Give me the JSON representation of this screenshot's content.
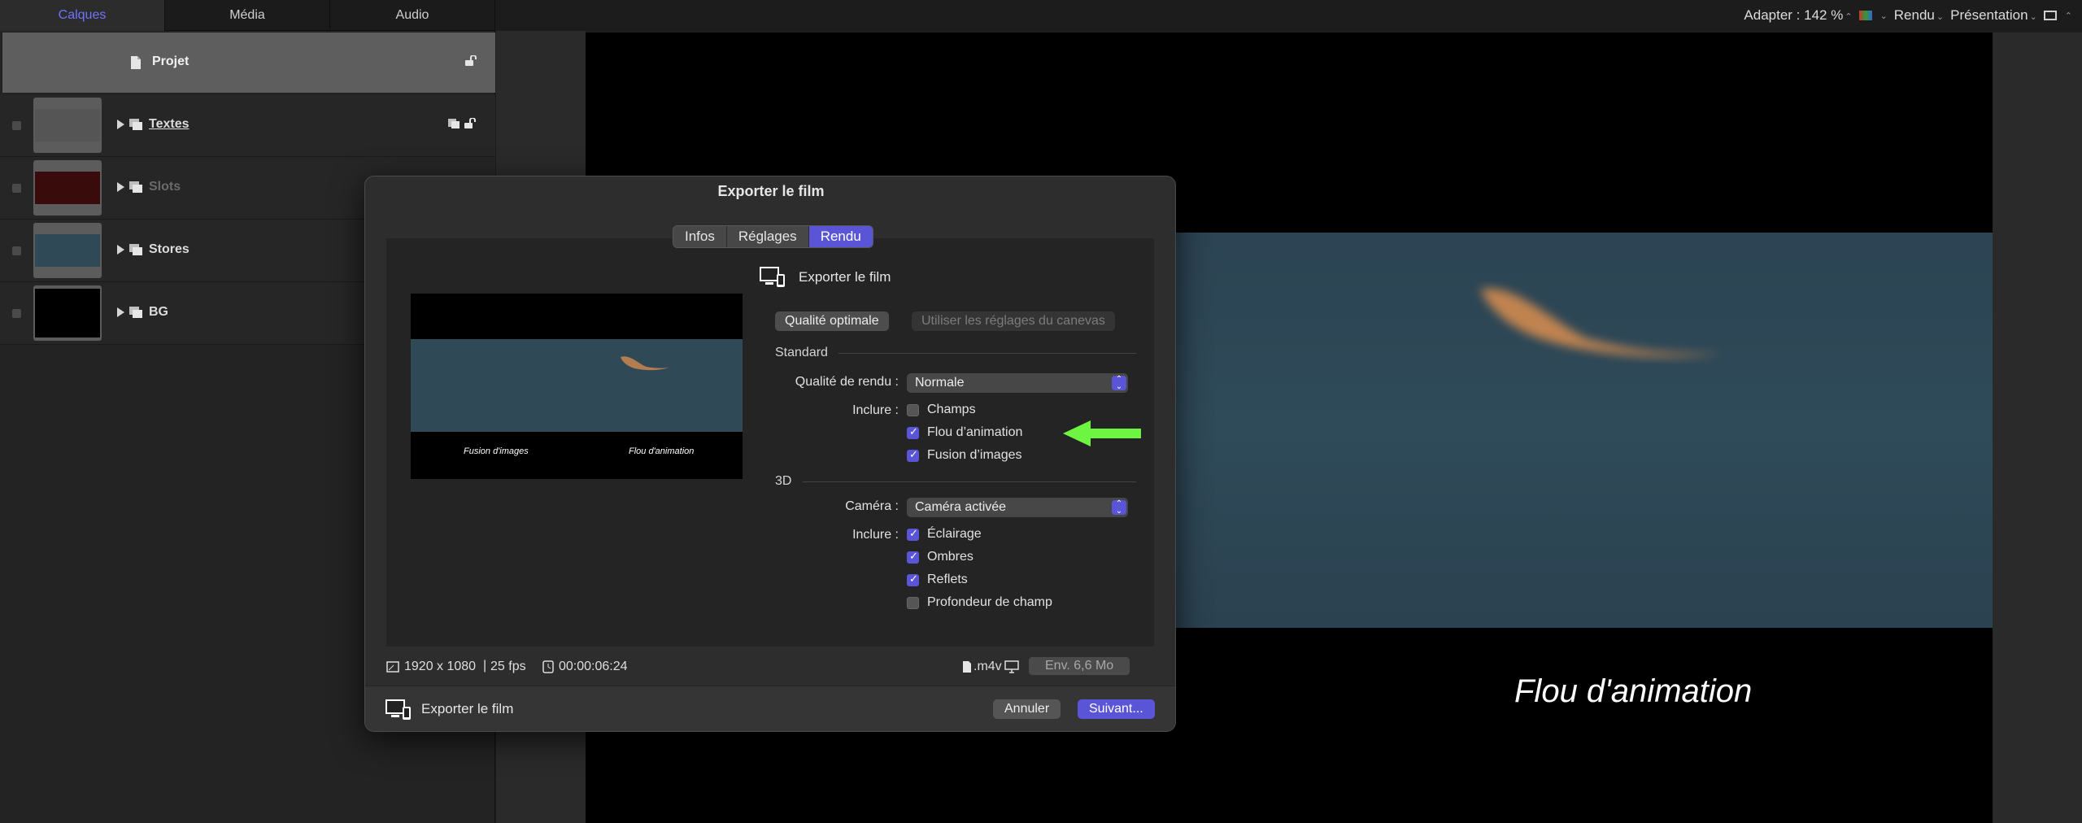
{
  "left_panel": {
    "tabs": [
      {
        "label": "Calques"
      },
      {
        "label": "Média"
      },
      {
        "label": "Audio"
      }
    ],
    "project": {
      "label": "Projet"
    },
    "layers": [
      {
        "label": "Textes"
      },
      {
        "label": "Slots"
      },
      {
        "label": "Stores"
      },
      {
        "label": "BG"
      }
    ]
  },
  "toolbar": {
    "fit": "Adapter : 142 %",
    "render": "Rendu",
    "presentation": "Présentation"
  },
  "canvas": {
    "caption": "Flou d'animation"
  },
  "dialog": {
    "title": "Exporter le film",
    "tabs": [
      {
        "label": "Infos"
      },
      {
        "label": "Réglages"
      },
      {
        "label": "Rendu"
      }
    ],
    "export_heading": "Exporter le film",
    "preview_captions": [
      "Fusion d'images",
      "Flou d'animation"
    ],
    "quality_optimal": "Qualité optimale",
    "use_canvas_settings": "Utiliser les réglages du canevas",
    "standard": {
      "heading": "Standard",
      "render_quality_label": "Qualité de rendu :",
      "render_quality_value": "Normale",
      "include_label": "Inclure :",
      "options": [
        {
          "label": "Champs",
          "checked": false
        },
        {
          "label": "Flou d’animation",
          "checked": true
        },
        {
          "label": "Fusion d’images",
          "checked": true
        }
      ]
    },
    "three_d": {
      "heading": "3D",
      "camera_label": "Caméra :",
      "camera_value": "Caméra activée",
      "include_label": "Inclure :",
      "options": [
        {
          "label": "Éclairage",
          "checked": true
        },
        {
          "label": "Ombres",
          "checked": true
        },
        {
          "label": "Reflets",
          "checked": true
        },
        {
          "label": "Profondeur de champ",
          "checked": false
        }
      ]
    },
    "info": {
      "resolution": "1920 x 1080",
      "fps": "25 fps",
      "duration": "00:00:06:24",
      "extension": ".m4v",
      "size": "Env. 6,6 Mo"
    },
    "footer_label": "Exporter le film",
    "cancel": "Annuler",
    "next": "Suivant..."
  },
  "colors": {
    "accent": "#5a55d6",
    "arrow": "#6ef542"
  }
}
